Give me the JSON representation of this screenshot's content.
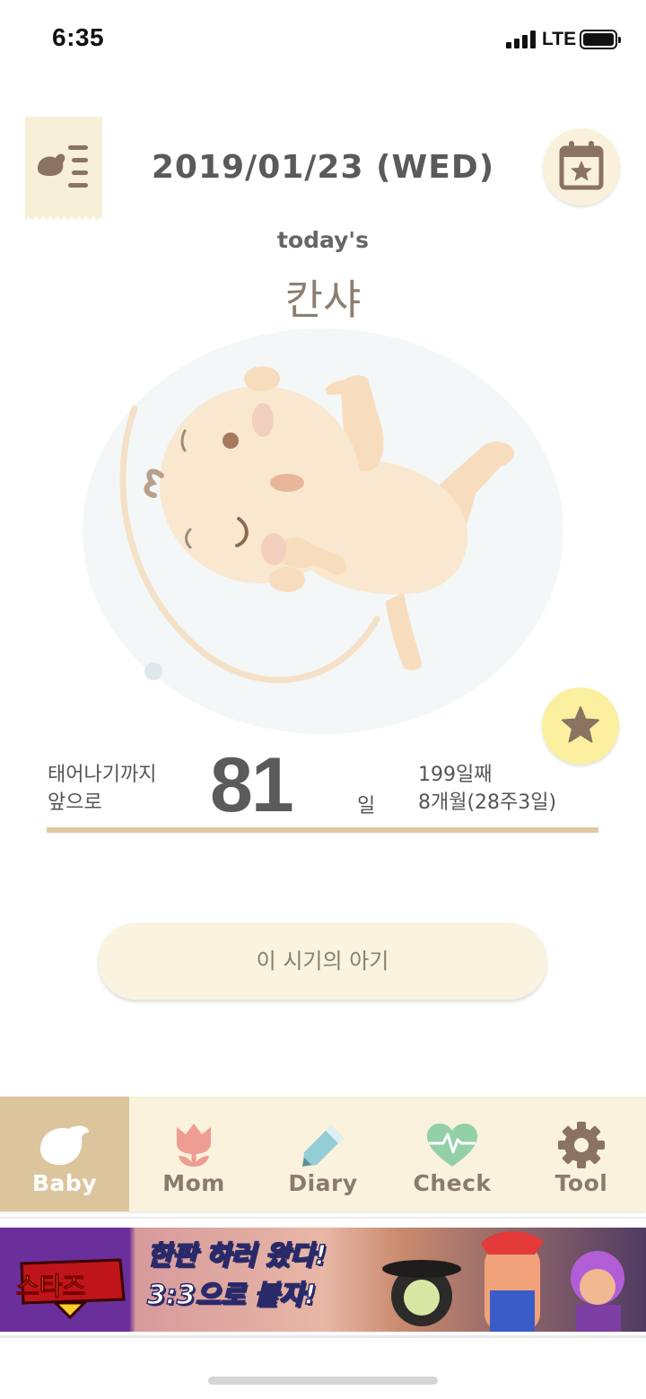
{
  "status_bar": {
    "time": "6:35",
    "network": "LTE"
  },
  "header": {
    "date": "2019/01/23 (WED)",
    "menu_icon": "list-menu-icon",
    "calendar_icon": "calendar-star-icon"
  },
  "today": {
    "label": "today's",
    "name": "칸샤"
  },
  "countdown": {
    "label_line1": "태어나기까지",
    "label_line2": "앞으로",
    "days_left": "81",
    "unit": "일",
    "info_line1": "199일째",
    "info_line2": "8개월(28주3일)"
  },
  "favorite_icon": "star-icon",
  "button": {
    "label": "이 시기의 아기"
  },
  "tabs": [
    {
      "label": "Baby",
      "icon": "bird-icon",
      "active": true
    },
    {
      "label": "Mom",
      "icon": "tulip-icon",
      "active": false
    },
    {
      "label": "Diary",
      "icon": "pencil-icon",
      "active": false
    },
    {
      "label": "Check",
      "icon": "heartbeat-icon",
      "active": false
    },
    {
      "label": "Tool",
      "icon": "gear-icon",
      "active": false
    }
  ],
  "ad": {
    "logo_text": "스타즈",
    "headline_line1": "한판 하러 왔다!",
    "headline_line2": "3:3으로 붙자!"
  },
  "colors": {
    "accent_tan": "#dcc59d",
    "cream": "#faf2dd",
    "star_yellow": "#fbf0a0",
    "text_brown": "#8a7b6c"
  }
}
